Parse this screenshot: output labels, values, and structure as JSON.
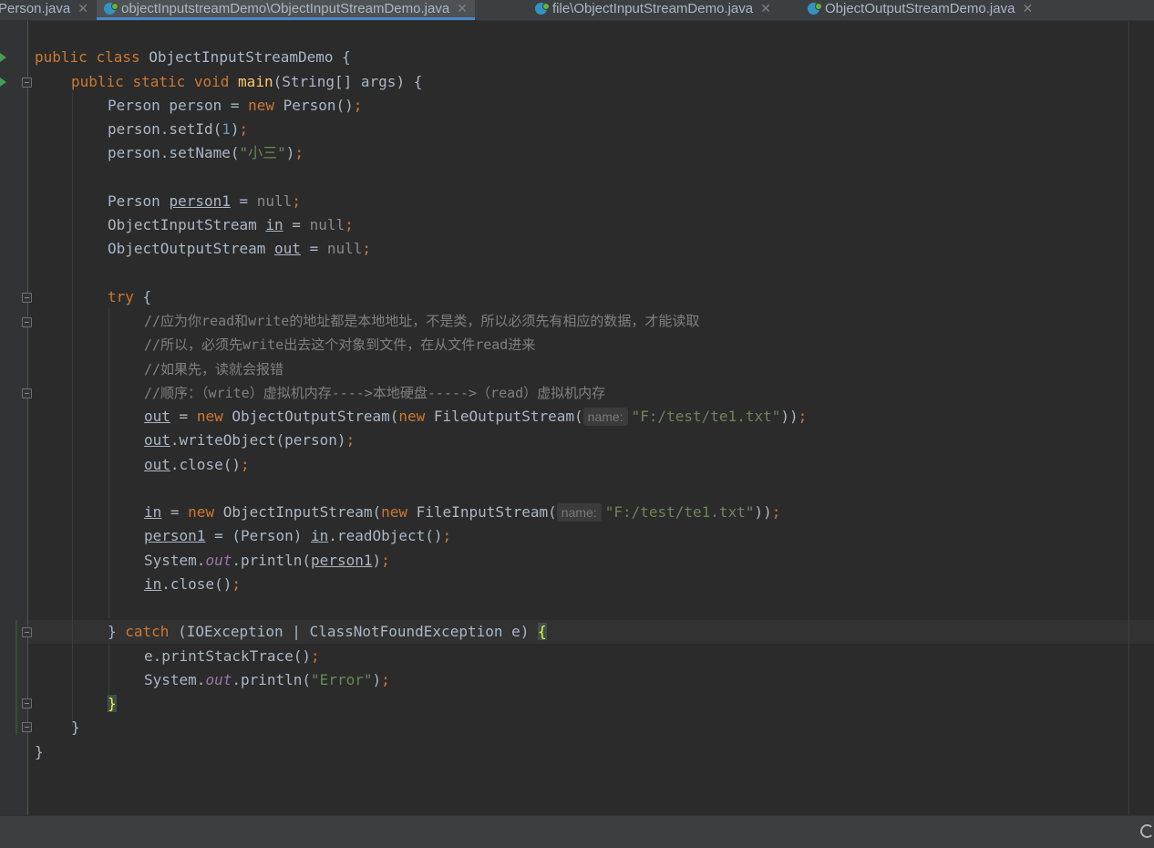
{
  "tabs": [
    {
      "label": "Person.java",
      "active": false,
      "icon": "java-class-icon"
    },
    {
      "label": "objectInputstreamDemo\\ObjectInputStreamDemo.java",
      "active": true,
      "icon": "java-class-icon"
    },
    {
      "label": "file\\ObjectInputStreamDemo.java",
      "active": false,
      "icon": "java-class-icon"
    },
    {
      "label": "ObjectOutputStreamDemo.java",
      "active": false,
      "icon": "java-class-icon"
    }
  ],
  "editor": {
    "hint_label": "name:",
    "lines": {
      "l1": [
        "public",
        "class",
        "ObjectInputStreamDemo {"
      ],
      "l2": [
        "public",
        "static",
        "void",
        "main",
        "(String[] args) {"
      ],
      "l3": [
        "Person person = ",
        "new",
        " Person()",
        ";"
      ],
      "l4": [
        "person.setId(",
        "1",
        ")",
        ";"
      ],
      "l5": [
        "person.setName(",
        "\"小三\"",
        ")",
        ";"
      ],
      "l7": [
        "Person ",
        "person1",
        " = ",
        "null",
        ";"
      ],
      "l8": [
        "ObjectInputStream ",
        "in",
        " = ",
        "null",
        ";"
      ],
      "l9": [
        "ObjectOutputStream ",
        "out",
        " = ",
        "null",
        ";"
      ],
      "l11": [
        "try",
        " {"
      ],
      "c1": "//应为你read和write的地址都是本地地址，不是类，所以必须先有相应的数据，才能读取",
      "c2": "//所以，必须先write出去这个对象到文件，在从文件read进来",
      "c3": "//如果先，读就会报错",
      "c4": "//顺序：（write）虚拟机内存---->本地硬盘----->（read）虚拟机内存",
      "l16": [
        "out",
        " = ",
        "new",
        " ObjectOutputStream(",
        "new",
        " FileOutputStream(",
        "\"F:/test/te1.txt\"",
        "))",
        ";"
      ],
      "l17": [
        "out",
        ".writeObject(person)",
        ";"
      ],
      "l18": [
        "out",
        ".close()",
        ";"
      ],
      "l20": [
        "in",
        " = ",
        "new",
        " ObjectInputStream(",
        "new",
        " FileInputStream(",
        "\"F:/test/te1.txt\"",
        "))",
        ";"
      ],
      "l21": [
        "person1",
        " = (Person) ",
        "in",
        ".readObject()",
        ";"
      ],
      "l22": [
        "System.",
        "out",
        ".println(",
        "person1",
        ")",
        ";"
      ],
      "l23": [
        "in",
        ".close()",
        ";"
      ],
      "l25": [
        "} ",
        "catch",
        " (IOException | ClassNotFoundException e) ",
        "{"
      ],
      "l26": [
        "e.printStackTrace()",
        ";"
      ],
      "l27": [
        "System.",
        "out",
        ".println(",
        "\"Error\"",
        ")",
        ";"
      ],
      "l28": "}",
      "l29": "}",
      "l30": "}"
    }
  }
}
